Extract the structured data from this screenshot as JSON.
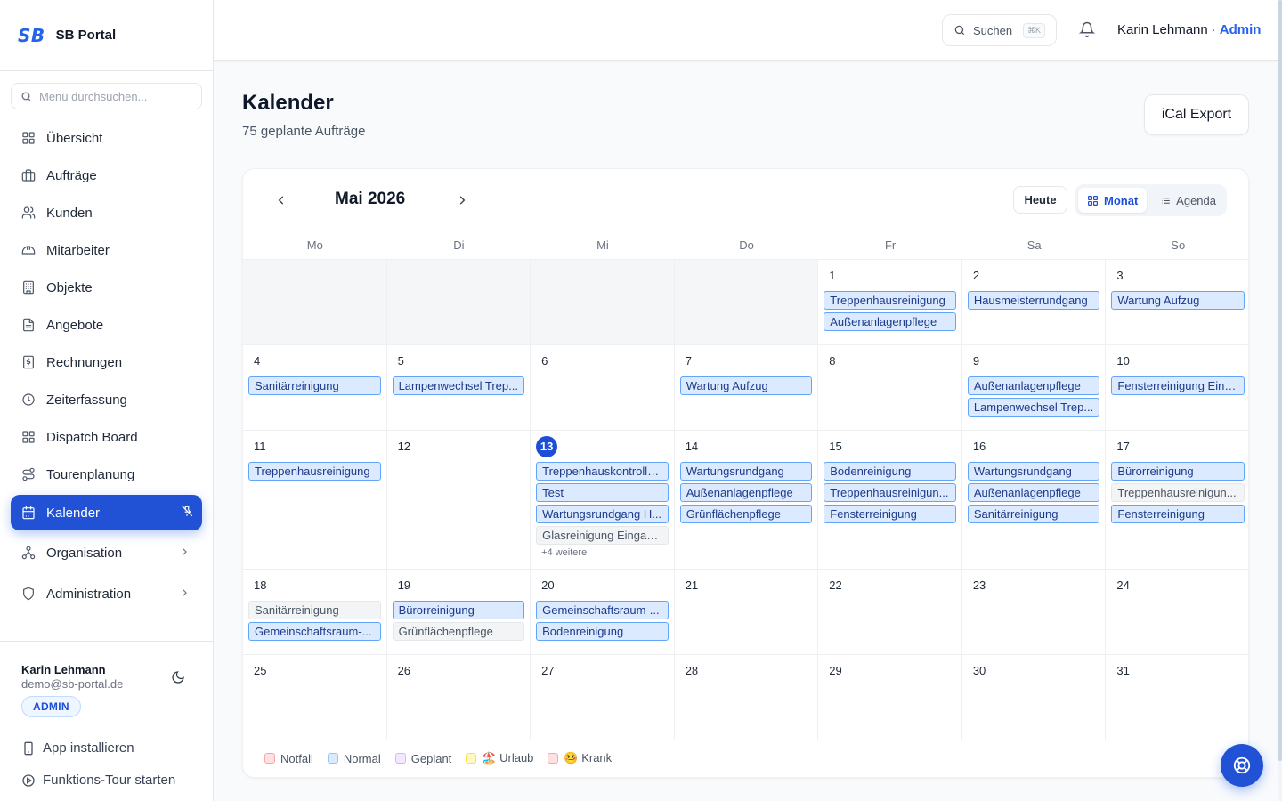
{
  "brand": {
    "logo": "SB",
    "name": "SB Portal"
  },
  "menu_search": {
    "placeholder": "Menü durchsuchen..."
  },
  "sidebar": {
    "items": [
      {
        "label": "Übersicht",
        "icon": "grid-icon"
      },
      {
        "label": "Aufträge",
        "icon": "briefcase-icon"
      },
      {
        "label": "Kunden",
        "icon": "users-icon"
      },
      {
        "label": "Mitarbeiter",
        "icon": "hard-hat-icon"
      },
      {
        "label": "Objekte",
        "icon": "building-icon"
      },
      {
        "label": "Angebote",
        "icon": "document-icon"
      },
      {
        "label": "Rechnungen",
        "icon": "invoice-icon"
      },
      {
        "label": "Zeiterfassung",
        "icon": "clock-icon"
      },
      {
        "label": "Dispatch Board",
        "icon": "dispatch-grid-icon"
      },
      {
        "label": "Tourenplanung",
        "icon": "route-icon"
      },
      {
        "label": "Kalender",
        "icon": "calendar-icon",
        "active": true
      },
      {
        "label": "Organisation",
        "icon": "organisation-icon"
      },
      {
        "label": "Administration",
        "icon": "shield-icon"
      }
    ]
  },
  "user": {
    "name": "Karin Lehmann",
    "email": "demo@sb-portal.de",
    "badge": "ADMIN"
  },
  "footer_links": {
    "install": "App installieren",
    "tour": "Funktions-Tour starten"
  },
  "topbar": {
    "search_label": "Suchen",
    "shortcut": "⌘K",
    "user_name": "Karin Lehmann",
    "separator": "·",
    "role": "Admin"
  },
  "page": {
    "title": "Kalender",
    "subtitle": "75 geplante Aufträge",
    "export_label": "iCal Export"
  },
  "calendar": {
    "month_label": "Mai 2026",
    "today_label": "Heute",
    "view_month": "Monat",
    "view_agenda": "Agenda",
    "weekdays": [
      "Mo",
      "Di",
      "Mi",
      "Do",
      "Fr",
      "Sa",
      "So"
    ],
    "today_day": "13",
    "weeks": [
      [
        {
          "day": "",
          "outside": true,
          "events": []
        },
        {
          "day": "",
          "outside": true,
          "events": []
        },
        {
          "day": "",
          "outside": true,
          "events": []
        },
        {
          "day": "",
          "outside": true,
          "events": []
        },
        {
          "day": "1",
          "events": [
            {
              "title": "Treppenhausreinigung",
              "status": "normal"
            },
            {
              "title": "Außenanlagenpflege",
              "status": "normal"
            }
          ]
        },
        {
          "day": "2",
          "events": [
            {
              "title": "Hausmeisterrundgang",
              "status": "normal"
            }
          ]
        },
        {
          "day": "3",
          "events": [
            {
              "title": "Wartung Aufzug",
              "status": "normal"
            }
          ]
        }
      ],
      [
        {
          "day": "4",
          "events": [
            {
              "title": "Sanitärreinigung",
              "status": "normal"
            }
          ]
        },
        {
          "day": "5",
          "events": [
            {
              "title": "Lampenwechsel Trep...",
              "status": "normal"
            }
          ]
        },
        {
          "day": "6",
          "events": []
        },
        {
          "day": "7",
          "events": [
            {
              "title": "Wartung Aufzug",
              "status": "normal"
            }
          ]
        },
        {
          "day": "8",
          "events": []
        },
        {
          "day": "9",
          "events": [
            {
              "title": "Außenanlagenpflege",
              "status": "normal"
            },
            {
              "title": "Lampenwechsel Trep...",
              "status": "normal"
            }
          ]
        },
        {
          "day": "10",
          "events": [
            {
              "title": "Fensterreinigung Eing...",
              "status": "normal"
            }
          ]
        }
      ],
      [
        {
          "day": "11",
          "events": [
            {
              "title": "Treppenhausreinigung",
              "status": "normal"
            }
          ]
        },
        {
          "day": "12",
          "events": []
        },
        {
          "day": "13",
          "today": true,
          "events": [
            {
              "title": "Treppenhauskontrolle...",
              "status": "normal"
            },
            {
              "title": "Test",
              "status": "normal"
            },
            {
              "title": "Wartungsrundgang H...",
              "status": "normal"
            },
            {
              "title": "Glasreinigung Eingan...",
              "status": "done"
            }
          ],
          "more": "+4 weitere"
        },
        {
          "day": "14",
          "events": [
            {
              "title": "Wartungsrundgang",
              "status": "normal"
            },
            {
              "title": "Außenanlagenpflege",
              "status": "normal"
            },
            {
              "title": "Grünflächenpflege",
              "status": "normal"
            }
          ]
        },
        {
          "day": "15",
          "events": [
            {
              "title": "Bodenreinigung",
              "status": "normal"
            },
            {
              "title": "Treppenhausreinigun...",
              "status": "normal"
            },
            {
              "title": "Fensterreinigung",
              "status": "normal"
            }
          ]
        },
        {
          "day": "16",
          "events": [
            {
              "title": "Wartungsrundgang",
              "status": "normal"
            },
            {
              "title": "Außenanlagenpflege",
              "status": "normal"
            },
            {
              "title": "Sanitärreinigung",
              "status": "normal"
            }
          ]
        },
        {
          "day": "17",
          "events": [
            {
              "title": "Bürorreinigung",
              "status": "normal"
            },
            {
              "title": "Treppenhausreinigun...",
              "status": "done"
            },
            {
              "title": "Fensterreinigung",
              "status": "normal"
            }
          ]
        }
      ],
      [
        {
          "day": "18",
          "events": [
            {
              "title": "Sanitärreinigung",
              "status": "done"
            },
            {
              "title": "Gemeinschaftsraum-...",
              "status": "normal"
            }
          ]
        },
        {
          "day": "19",
          "events": [
            {
              "title": "Bürorreinigung",
              "status": "normal"
            },
            {
              "title": "Grünflächenpflege",
              "status": "done"
            }
          ]
        },
        {
          "day": "20",
          "events": [
            {
              "title": "Gemeinschaftsraum-...",
              "status": "normal"
            },
            {
              "title": "Bodenreinigung",
              "status": "normal"
            }
          ]
        },
        {
          "day": "21",
          "events": []
        },
        {
          "day": "22",
          "events": []
        },
        {
          "day": "23",
          "events": []
        },
        {
          "day": "24",
          "events": []
        }
      ],
      [
        {
          "day": "25",
          "events": []
        },
        {
          "day": "26",
          "events": []
        },
        {
          "day": "27",
          "events": []
        },
        {
          "day": "28",
          "events": []
        },
        {
          "day": "29",
          "events": []
        },
        {
          "day": "30",
          "events": []
        },
        {
          "day": "31",
          "events": []
        }
      ]
    ],
    "legend": [
      {
        "label": "Notfall",
        "bg": "#fee2e2",
        "border": "#fca5a5"
      },
      {
        "label": "Normal",
        "bg": "#dbeafe",
        "border": "#93c5fd"
      },
      {
        "label": "Geplant",
        "bg": "#f3e8ff",
        "border": "#d8b4fe"
      },
      {
        "label": "🏖️ Urlaub",
        "bg": "#fef9c3",
        "border": "#fde047"
      },
      {
        "label": "🤒 Krank",
        "bg": "#fee2e2",
        "border": "#fca5a5"
      }
    ]
  },
  "colors": {
    "accent": "#2152d6",
    "event_bg": "#dbeafe",
    "event_border": "#60a5fa"
  }
}
